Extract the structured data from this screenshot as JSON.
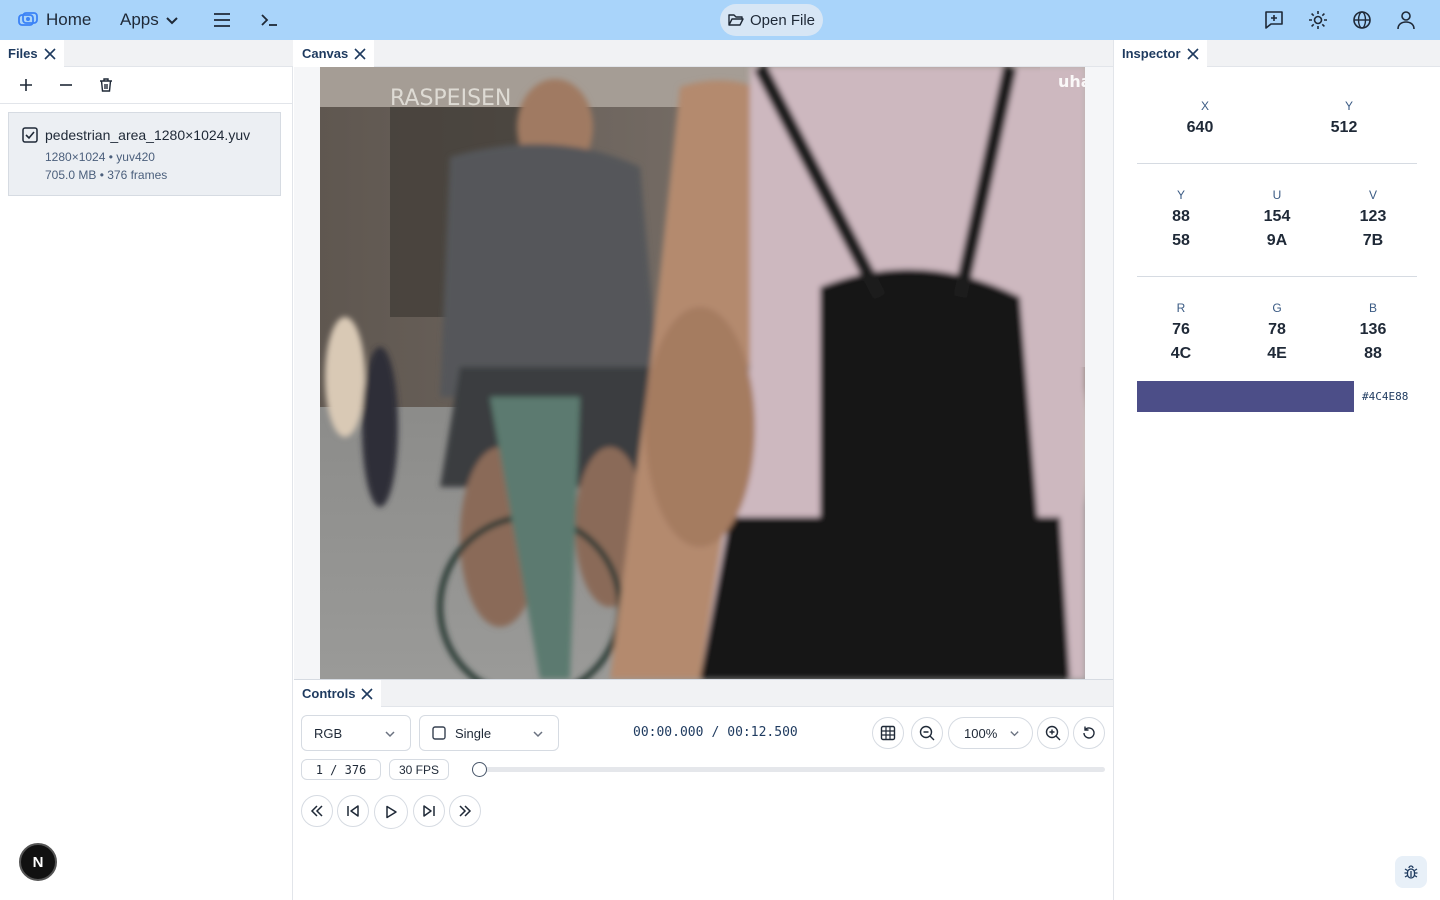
{
  "topbar": {
    "home_label": "Home",
    "apps_label": "Apps",
    "open_file_label": "Open File",
    "icons": [
      "logo-icon",
      "chevron-down-icon",
      "menu-icon",
      "terminal-icon",
      "folder-open-icon",
      "feedback-icon",
      "sun-icon",
      "globe-icon",
      "user-icon"
    ]
  },
  "files": {
    "tab_label": "Files",
    "items": [
      {
        "name": "pedestrian_area_1280×1024.yuv",
        "meta1": "1280×1024 • yuv420",
        "meta2": "705.0 MB • 376 frames"
      }
    ]
  },
  "canvas": {
    "tab_label": "Canvas",
    "overlay_text": "uha",
    "sign_text": "RASPEISEN"
  },
  "controls": {
    "tab_label": "Controls",
    "color_mode": "RGB",
    "view_mode": "Single",
    "time_current": "00:00.000",
    "time_separator": "/",
    "time_total": "00:12.500",
    "zoom": "100%",
    "frame_indicator": "1 / 376",
    "fps": "30 FPS",
    "seek_progress": 0
  },
  "inspector": {
    "tab_label": "Inspector",
    "coords": {
      "x_label": "X",
      "x_value": "640",
      "y_label": "Y",
      "y_value": "512"
    },
    "yuv": {
      "y_label": "Y",
      "y_dec": "88",
      "y_hex": "58",
      "u_label": "U",
      "u_dec": "154",
      "u_hex": "9A",
      "v_label": "V",
      "v_dec": "123",
      "v_hex": "7B"
    },
    "rgb": {
      "r_label": "R",
      "r_dec": "76",
      "r_hex": "4C",
      "g_label": "G",
      "g_dec": "78",
      "g_hex": "4E",
      "b_label": "B",
      "b_dec": "136",
      "b_hex": "88"
    },
    "swatch_color": "#4C4E88",
    "swatch_hex": "#4C4E88"
  },
  "badge": {
    "letter": "N"
  },
  "colors": {
    "topbar": "#a9d4fa",
    "accent": "#1e3a5f",
    "swatch": "#4C4E88"
  }
}
